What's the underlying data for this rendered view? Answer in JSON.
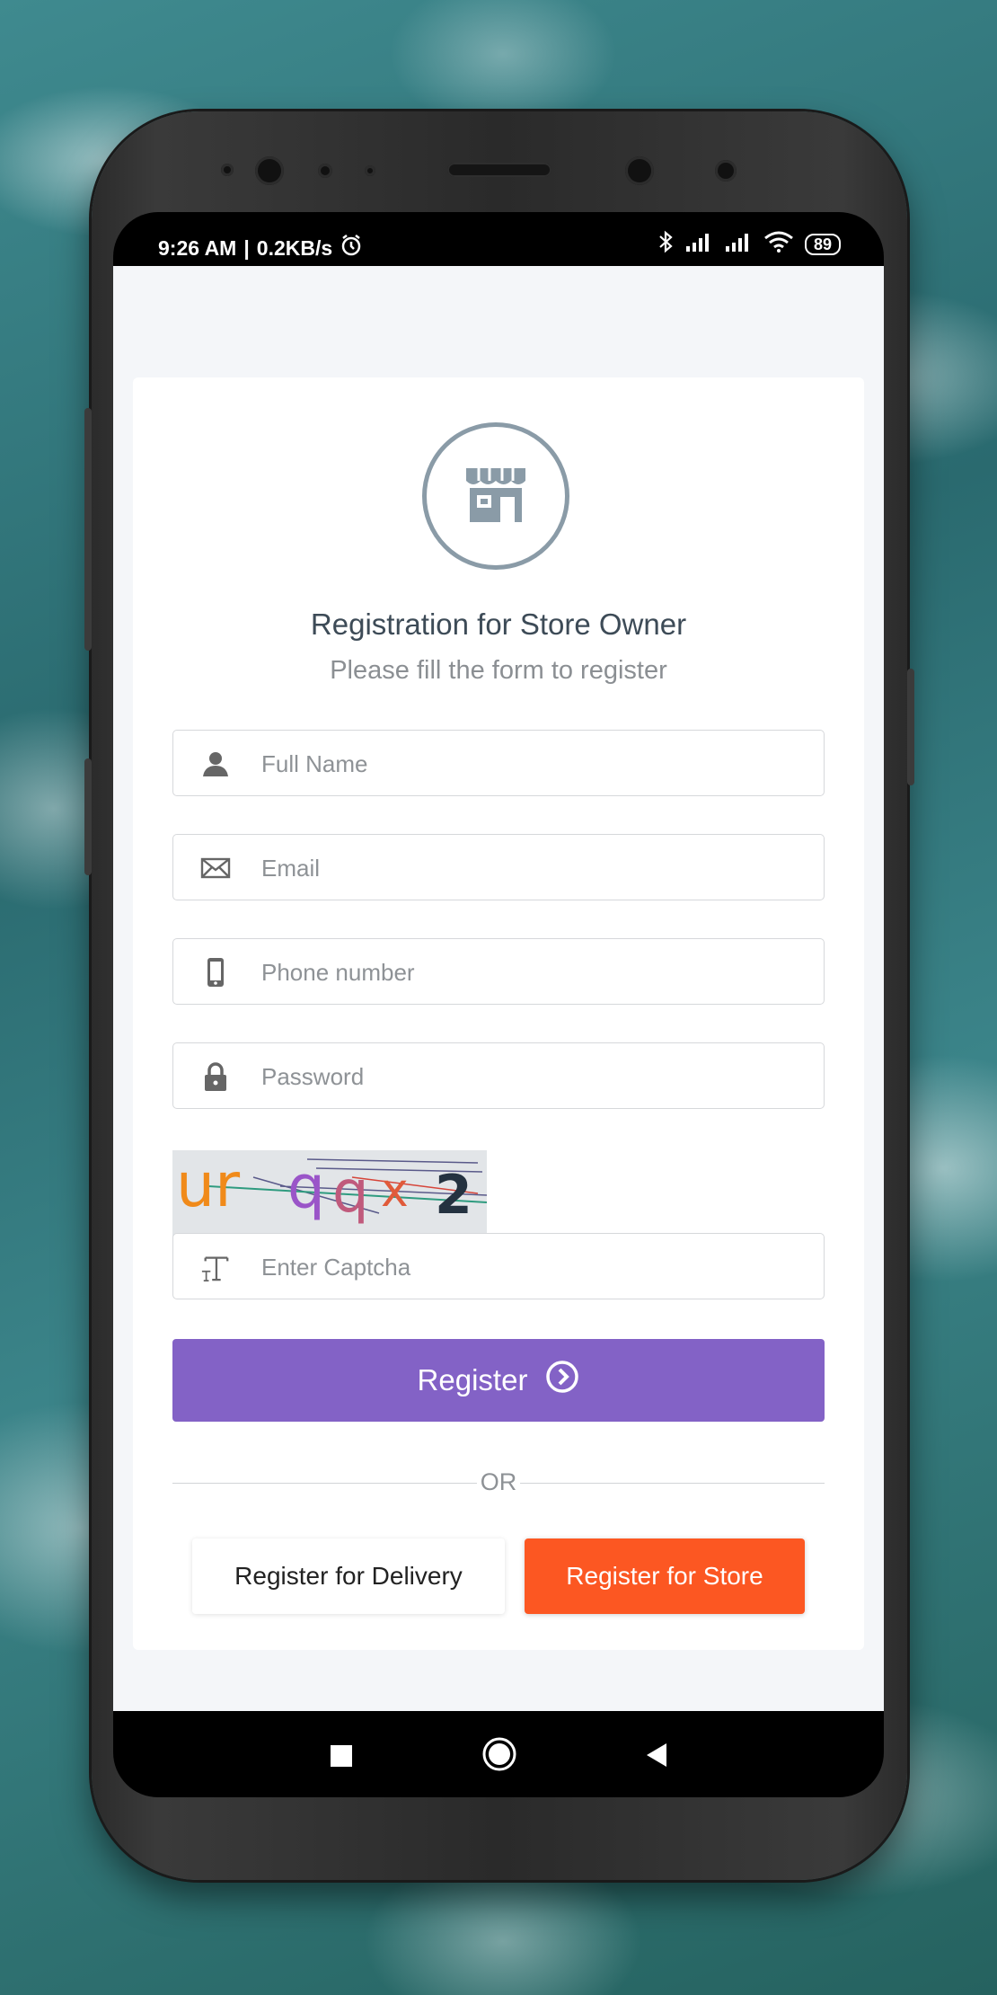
{
  "status_bar": {
    "time": "9:26 AM",
    "separator": "|",
    "speed": "0.2KB/s",
    "battery": "89"
  },
  "form": {
    "title": "Registration for Store Owner",
    "subtitle": "Please fill the form to register",
    "full_name_placeholder": "Full Name",
    "email_placeholder": "Email",
    "phone_placeholder": "Phone number",
    "password_placeholder": "Password",
    "captcha_text": "ur qqx 2",
    "captcha_placeholder": "Enter Captcha",
    "register_label": "Register",
    "or_label": "OR",
    "register_delivery_label": "Register for Delivery",
    "register_store_label": "Register for Store"
  },
  "colors": {
    "accent_purple": "#8362c6",
    "accent_orange": "#fc5722",
    "icon_gray": "#8a9ba7"
  },
  "icons": [
    "store-icon",
    "person-icon",
    "envelope-icon",
    "mobile-phone-icon",
    "lock-icon",
    "text-icon",
    "arrow-circle-right-icon",
    "nav-square-icon",
    "nav-home-icon",
    "nav-back-icon"
  ]
}
